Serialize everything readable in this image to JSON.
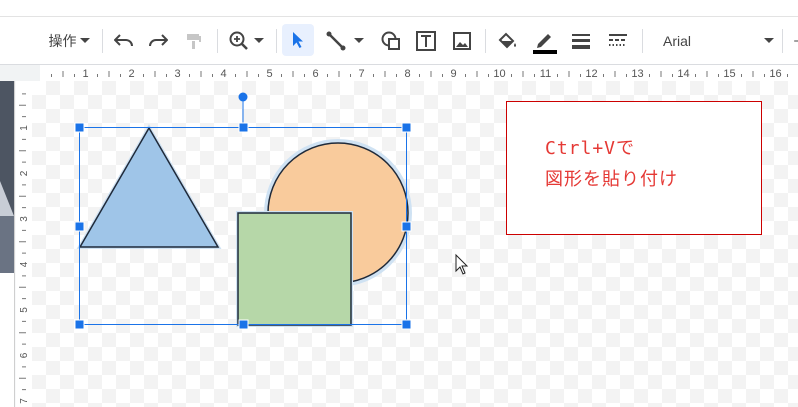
{
  "toolbar": {
    "menu_label": "操作",
    "font_name": "Arial",
    "icons": [
      "undo-icon",
      "redo-icon",
      "paint-format-icon",
      "zoom-icon",
      "select-icon",
      "line-icon",
      "shape-icon",
      "textbox-icon",
      "image-icon",
      "fill-color-icon",
      "border-color-icon",
      "border-weight-icon",
      "border-dash-icon"
    ]
  },
  "ruler": {
    "horizontal_ticks": [
      "1",
      "2",
      "3",
      "4",
      "5",
      "6",
      "7",
      "8",
      "9",
      "10",
      "11",
      "12",
      "13",
      "14",
      "15",
      "16"
    ],
    "vertical_ticks": [
      "1",
      "2",
      "3",
      "4",
      "5",
      "6",
      "7"
    ]
  },
  "canvas": {
    "shapes": [
      {
        "kind": "triangle",
        "fill": "#9fc5e8",
        "stroke": "#1f2a3a"
      },
      {
        "kind": "circle",
        "fill": "#f9cb9c",
        "stroke": "#1f2a3a"
      },
      {
        "kind": "square",
        "fill": "#b6d7a8",
        "stroke": "#1f2a3a"
      }
    ],
    "selection_color": "#1a73e8",
    "textbox": {
      "line1": "Ctrl+Vで",
      "line2": "図形を貼り付け",
      "text_color": "#e53935",
      "border_color": "#cc0000"
    }
  }
}
